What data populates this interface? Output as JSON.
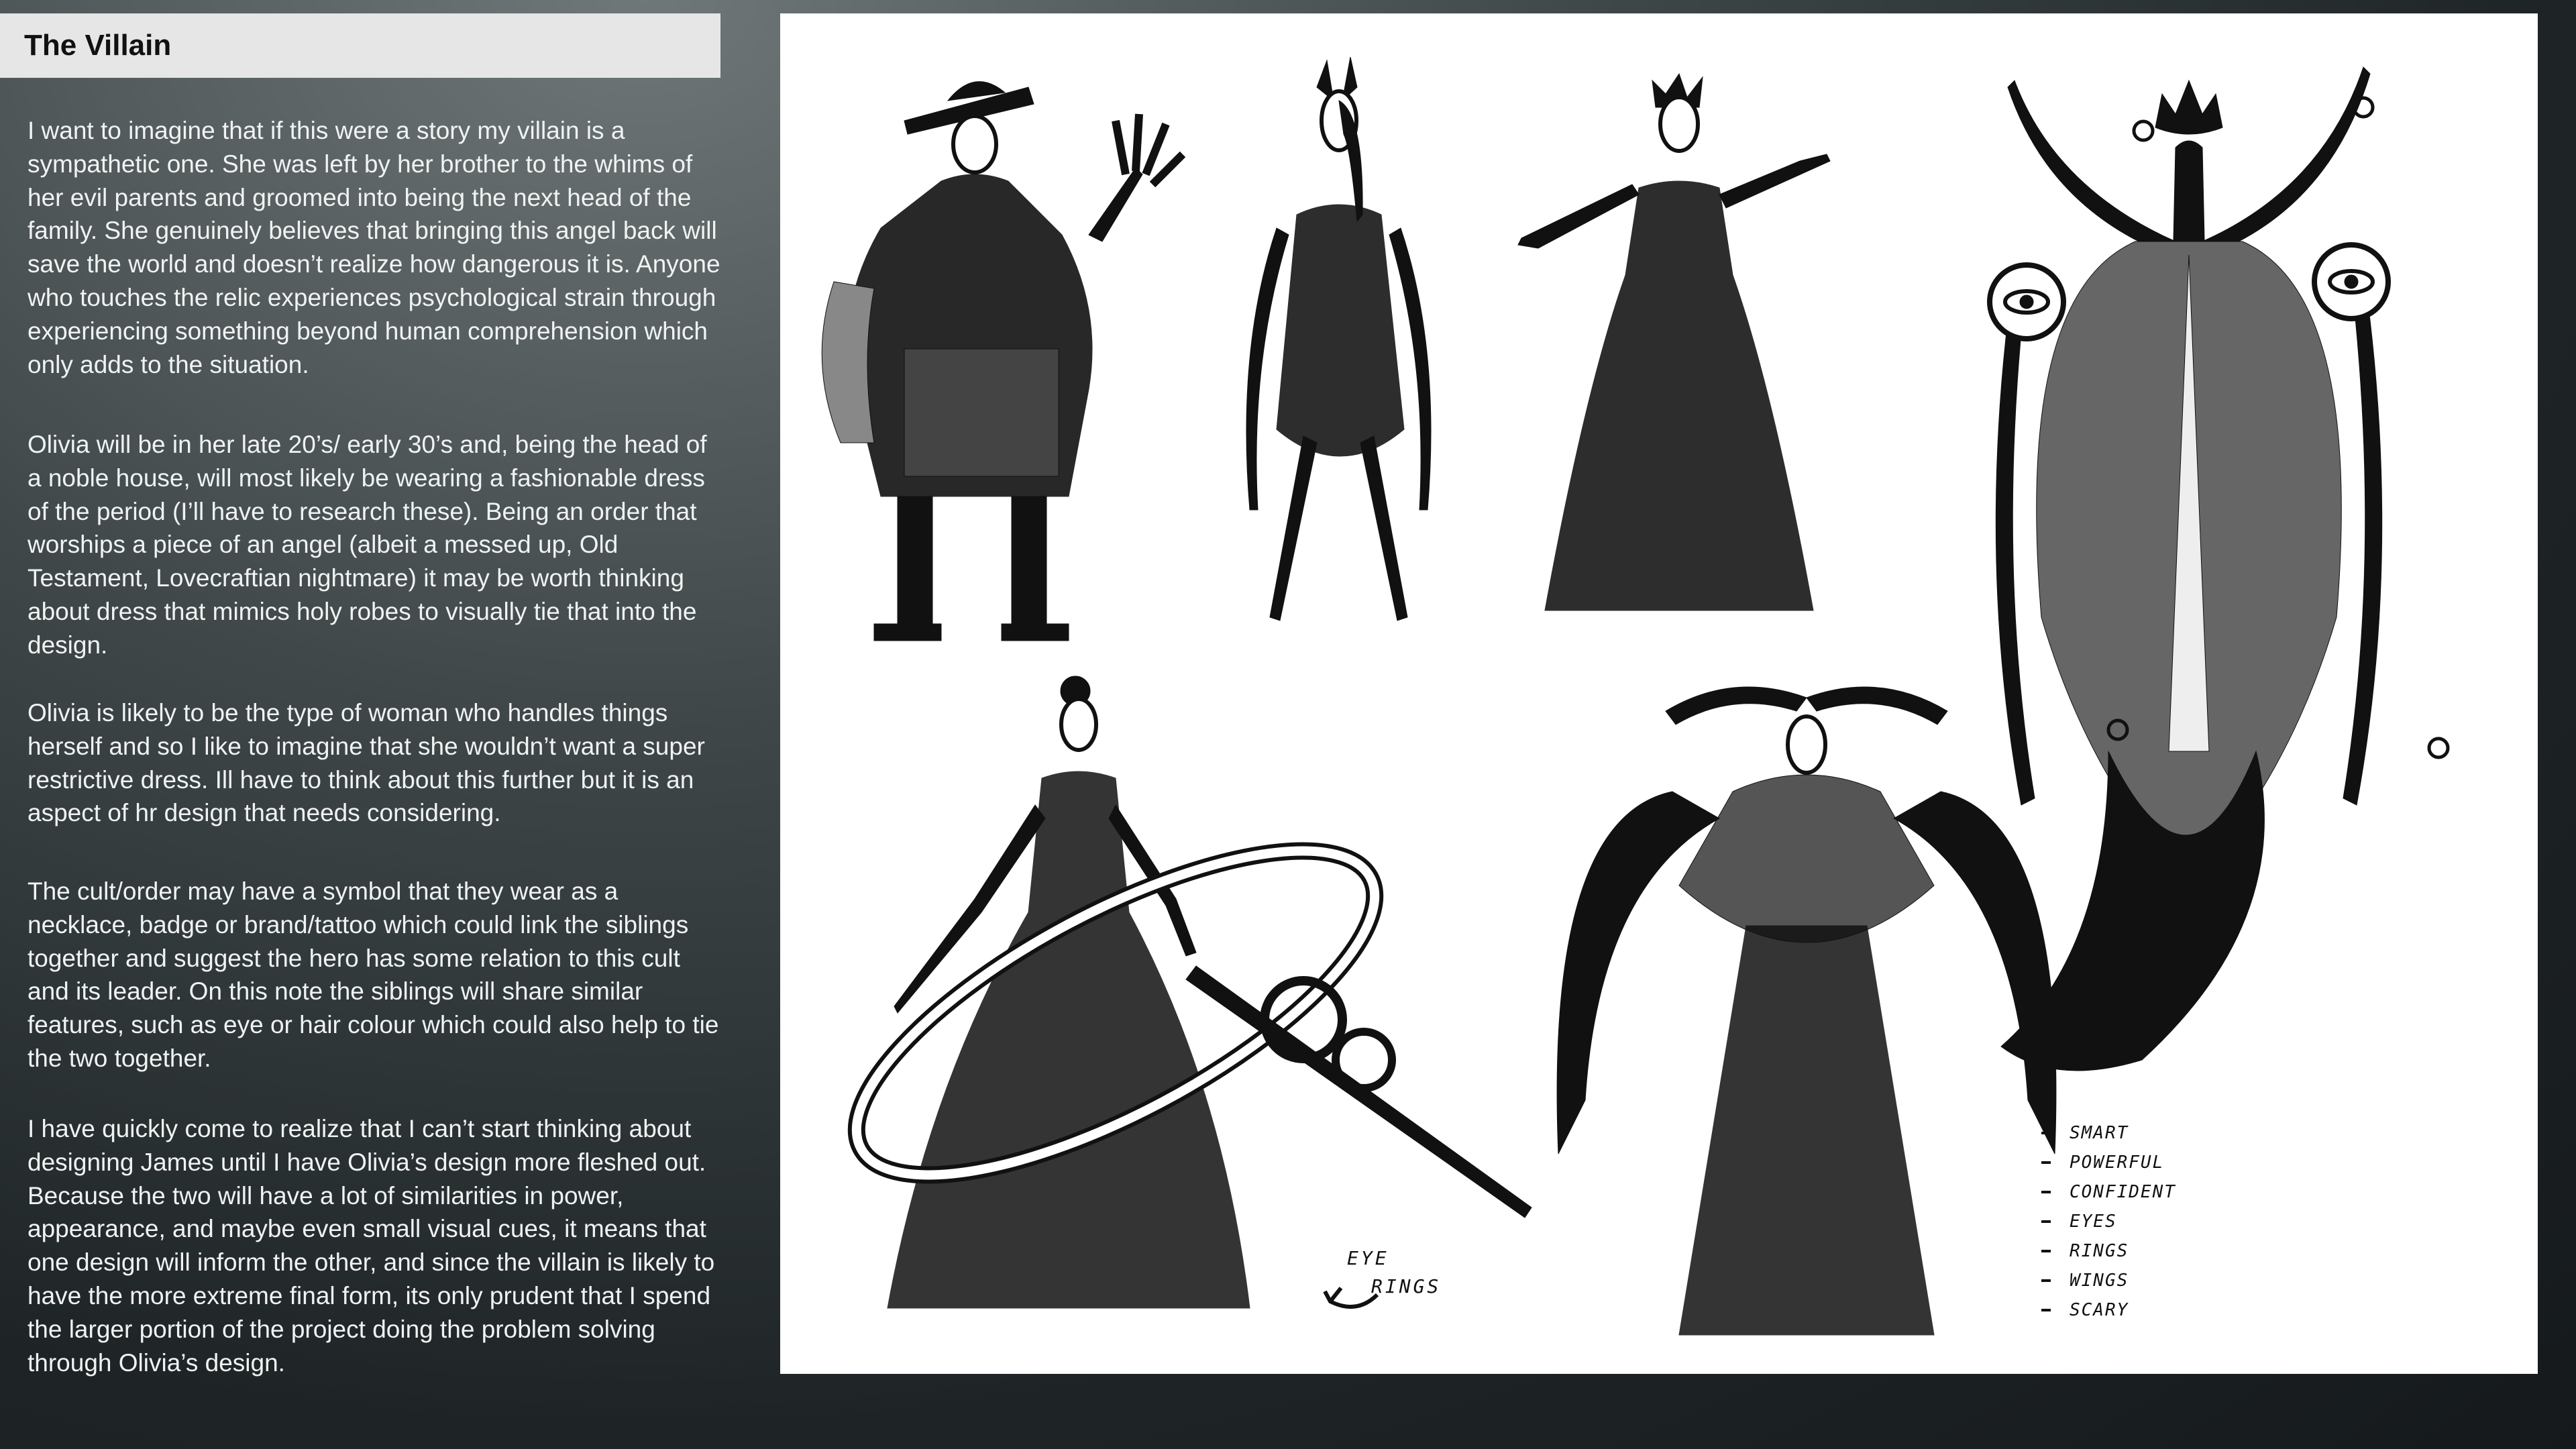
{
  "title": "The Villain",
  "paragraphs": [
    "I want to imagine that if this were a story my villain is a sympathetic one. She was left by her brother to the whims of her evil parents and groomed into being the next head of the family. She genuinely believes that bringing this angel back will save the world and doesn’t realize how dangerous it is. Anyone who touches the relic experiences psychological strain through experiencing something beyond human comprehension which only adds to the situation.",
    "Olivia will be in her late 20’s/ early 30’s and, being the head of a noble house, will most likely be wearing a fashionable dress of the period (I’ll have to research these). Being an order that worships a piece of an angel (albeit a messed up, Old Testament, Lovecraftian nightmare) it may be worth thinking about dress that mimics holy robes to visually tie that into the design.",
    "Olivia is likely to be the type of woman who handles things herself and so I like to imagine that she wouldn’t want a super restrictive dress. Ill have to think about this further but it is an aspect of hr design that needs considering.",
    "The cult/order may have a symbol that they wear as a necklace, badge or brand/tattoo which could link the siblings together and suggest the hero has some relation to this cult and its leader. On this note the siblings will share similar features, such as eye or hair colour which could also help to tie the two together.",
    "I have quickly come to realize that I can’t start thinking about designing James until I have Olivia’s design more fleshed out. Because the two will have a lot of similarities in power, appearance, and maybe even small visual cues, it means that one design will inform the other, and since the villain is likely to have the more extreme final form, its only prudent that I spend the larger portion of the project doing the problem solving through Olivia’s design."
  ],
  "annotations": {
    "notes": [
      "SMART",
      "POWERFUL",
      "CONFIDENT",
      "EYES",
      "RINGS",
      "WINGS",
      "SCARY"
    ],
    "callout": [
      "EYE",
      "RINGS"
    ]
  },
  "colors": {
    "title_bar": "#e6e6e6",
    "body_text": "#f1f3f3",
    "sketch_ink": "#111111",
    "panel": "#ffffff"
  }
}
